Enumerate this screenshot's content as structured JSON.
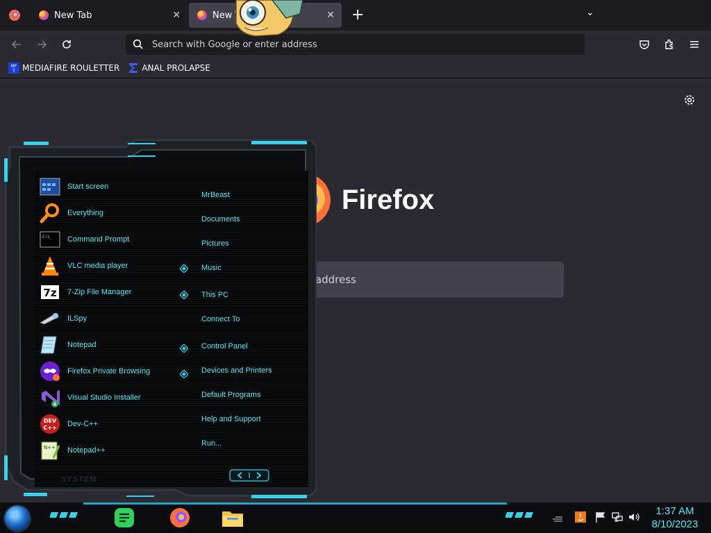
{
  "browser": {
    "tabs": [
      {
        "title": "New Tab",
        "close": "✕"
      },
      {
        "title": "New Tab",
        "close": "✕"
      }
    ],
    "new_tab_symbol": "+",
    "tab_list_symbol": "⌄",
    "url_placeholder": "Search with Google or enter address",
    "bookmarks": [
      {
        "label": "MEDIAFIRE ROULETTER",
        "icon": "mediafire-icon"
      },
      {
        "label": "ANAL PROLAPSE",
        "icon": "sigma-icon"
      }
    ]
  },
  "newtab": {
    "brand": "Firefox",
    "search_placeholder": "address"
  },
  "start_menu": {
    "programs": [
      {
        "label": "Start screen",
        "icon": "start-screen-icon"
      },
      {
        "label": "Everything",
        "icon": "magnifier-icon"
      },
      {
        "label": "Command Prompt",
        "icon": "cmd-icon"
      },
      {
        "label": "VLC media player",
        "icon": "vlc-cone-icon"
      },
      {
        "label": "7-Zip File Manager",
        "icon": "7zip-icon"
      },
      {
        "label": "ILSpy",
        "icon": "ilspy-icon"
      },
      {
        "label": "Notepad",
        "icon": "notepad-icon"
      },
      {
        "label": "Firefox Private Browsing",
        "icon": "private-browsing-icon"
      },
      {
        "label": "Visual Studio Installer",
        "icon": "visual-studio-icon"
      },
      {
        "label": "Dev-C++",
        "icon": "devcpp-icon"
      },
      {
        "label": "Notepad++",
        "icon": "notepadpp-icon"
      }
    ],
    "places": [
      {
        "label": "MrBeast"
      },
      {
        "label": "Documents"
      },
      {
        "label": "Pictures"
      },
      {
        "label": "Music"
      },
      {
        "label": "This PC"
      },
      {
        "label": "Connect To"
      },
      {
        "label": "Control Panel"
      },
      {
        "label": "Devices and Printers"
      },
      {
        "label": "Default Programs"
      },
      {
        "label": "Help and Support"
      },
      {
        "label": "Run..."
      }
    ],
    "footer_label": "SYSTEM"
  },
  "taskbar": {
    "time": "1:37 AM",
    "date": "8/10/2023"
  },
  "colors": {
    "accent_cyan": "#59e6ef",
    "chrome_dark": "#1c1b22",
    "page_bg": "#2b2a33"
  }
}
